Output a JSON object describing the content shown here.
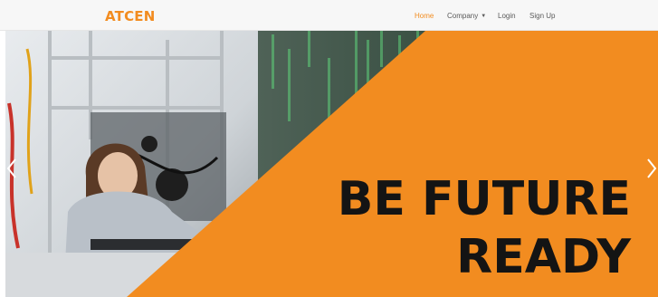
{
  "brand": {
    "name": "ATCEN",
    "color": "#f28c20"
  },
  "nav": {
    "items": [
      {
        "label": "Home",
        "active": true
      },
      {
        "label": "Company",
        "dropdown": true
      },
      {
        "label": "Login"
      },
      {
        "label": "Sign Up"
      }
    ]
  },
  "hero": {
    "headline_line1": "BE FUTURE",
    "headline_line2": "READY",
    "accent_color": "#f28c20",
    "text_color": "#141414"
  },
  "carousel": {
    "prev_icon": "chevron-left-icon",
    "next_icon": "chevron-right-icon"
  }
}
